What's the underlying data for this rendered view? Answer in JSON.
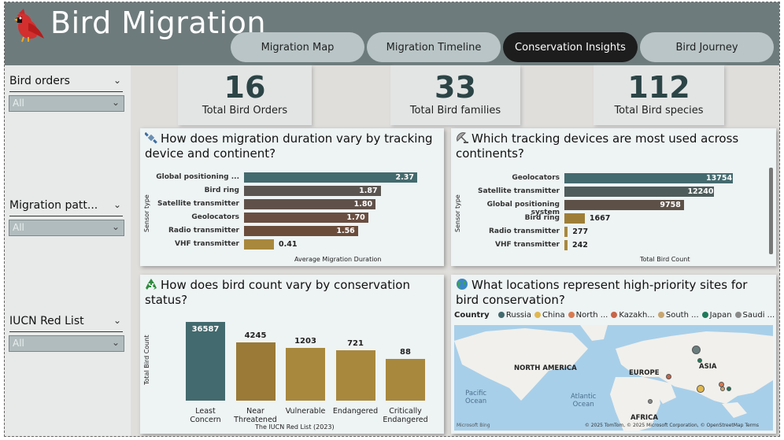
{
  "app": {
    "title": "Bird Migration"
  },
  "tabs": [
    {
      "label": "Migration Map",
      "active": false
    },
    {
      "label": "Migration Timeline",
      "active": false
    },
    {
      "label": "Conservation Insights",
      "active": true
    },
    {
      "label": "Bird Journey",
      "active": false
    }
  ],
  "filters": [
    {
      "label": "Bird orders",
      "value": "All"
    },
    {
      "label": "Migration patt...",
      "value": "All"
    },
    {
      "label": "IUCN Red List",
      "value": "All"
    }
  ],
  "kpis": [
    {
      "value": "16",
      "label": "Total Bird Orders"
    },
    {
      "value": "33",
      "label": "Total Bird families"
    },
    {
      "value": "112",
      "label": "Total Bird species"
    }
  ],
  "charts": {
    "duration": {
      "title": "How does migration duration vary by tracking device and continent?",
      "icon": "satellite-icon",
      "chart_data": {
        "type": "bar",
        "orientation": "horizontal",
        "categories": [
          "Global positioning ...",
          "Bird ring",
          "Satellite transmitter",
          "Geolocators",
          "Radio transmitter",
          "VHF transmitter"
        ],
        "values": [
          2.37,
          1.87,
          1.8,
          1.7,
          1.56,
          0.41
        ],
        "labels": [
          "2.37",
          "1.87",
          "1.80",
          "1.70",
          "1.56",
          "0.41"
        ],
        "colors": [
          "#436a6e",
          "#5a5551",
          "#5f5149",
          "#6a4e41",
          "#6b4c3b",
          "#a8883d"
        ],
        "xlabel": "Average Migration Duration",
        "ylabel": "Sensor type",
        "xlim": [
          0,
          2.37
        ]
      }
    },
    "devices": {
      "title": "Which tracking devices are most used across continents?",
      "icon": "satellite-dish-icon",
      "chart_data": {
        "type": "bar",
        "orientation": "horizontal",
        "categories": [
          "Geolocators",
          "Satellite transmitter",
          "Global positioning system",
          "Bird ring",
          "Radio transmitter",
          "VHF transmitter"
        ],
        "values": [
          13754,
          12240,
          9758,
          1667,
          277,
          242
        ],
        "labels": [
          "13754",
          "12240",
          "9758",
          "1667",
          "277",
          "242"
        ],
        "colors": [
          "#436a6e",
          "#4e5c5b",
          "#5d5147",
          "#9e7e37",
          "#a8883d",
          "#a8883d"
        ],
        "xlabel": "Total Bird Count",
        "ylabel": "Sensor type",
        "xlim": [
          0,
          13754
        ]
      }
    },
    "status": {
      "title": "How does bird count vary by conservation status?",
      "icon": "recycle-icon",
      "chart_data": {
        "type": "bar",
        "orientation": "vertical",
        "categories": [
          "Least Concern",
          "Near Threatened",
          "Vulnerable",
          "Endangered",
          "Critically Endangered"
        ],
        "category_lines": [
          [
            "Least",
            "Concern"
          ],
          [
            "Near",
            "Threatened"
          ],
          [
            "Vulnerable"
          ],
          [
            "Endangered"
          ],
          [
            "Critically",
            "Endangered"
          ]
        ],
        "values": [
          36587,
          4245,
          1203,
          721,
          88
        ],
        "labels": [
          "36587",
          "4245",
          "1203",
          "721",
          "88"
        ],
        "colors": [
          "#436a6e",
          "#9a7a36",
          "#a8883d",
          "#a8883d",
          "#a8883d"
        ],
        "xlabel": "The IUCN Red List (2023)",
        "ylabel": "Total Bird Count"
      }
    },
    "locations": {
      "title": "What locations represent high-priority sites for bird conservation?",
      "icon": "globe-icon",
      "legend_title": "Country",
      "legend": [
        {
          "name": "Russia",
          "color": "#436a6e"
        },
        {
          "name": "China",
          "color": "#e0b850"
        },
        {
          "name": "North ...",
          "color": "#d97a50"
        },
        {
          "name": "Kazakh...",
          "color": "#c86448"
        },
        {
          "name": "South ...",
          "color": "#c8a56e"
        },
        {
          "name": "Japan",
          "color": "#1f7a5a"
        },
        {
          "name": "Saudi ...",
          "color": "#8a8a8a"
        }
      ],
      "map_labels": [
        "NORTH AMERICA",
        "EUROPE",
        "ASIA",
        "AFRICA"
      ],
      "ocean_labels": [
        [
          "Pacific",
          "Ocean"
        ],
        [
          "Atlantic",
          "Ocean"
        ]
      ],
      "attribution": "© 2025 TomTom, © 2025 Microsoft Corporation, © OpenStreetMap  Terms",
      "provider": "Microsoft Bing"
    }
  }
}
